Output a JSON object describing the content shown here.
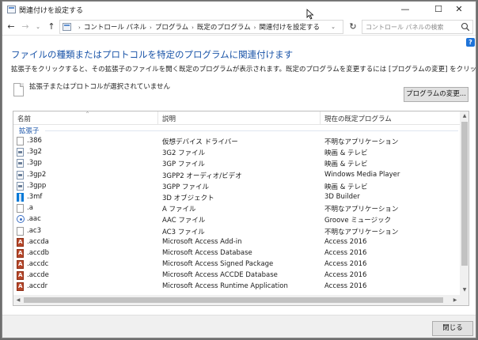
{
  "window": {
    "title": "関連付けを設定する",
    "controls": {
      "minimize": "—",
      "maximize": "☐",
      "close": "✕"
    }
  },
  "nav": {
    "back": "←",
    "forward": "→",
    "recent": "⌄",
    "up": "↑",
    "breadcrumbs": [
      "コントロール パネル",
      "プログラム",
      "既定のプログラム",
      "関連付けを設定する"
    ],
    "breadcrumb_sep": "›",
    "refresh": "↻",
    "address_dropdown": "⌄",
    "search_placeholder": "コントロール パネルの検索"
  },
  "help_label": "?",
  "page": {
    "heading": "ファイルの種類またはプロトコルを特定のプログラムに関連付けます",
    "description": "拡張子をクリックすると、その拡張子のファイルを開く既定のプログラムが表示されます。既定のプログラムを変更するには [プログラムの変更] をクリックしてください。",
    "no_selection": "拡張子またはプロトコルが選択されていません",
    "change_button": "プログラムの変更..."
  },
  "list": {
    "columns": [
      "名前",
      "説明",
      "現在の既定プログラム"
    ],
    "sort_indicator": "^",
    "group": "拡張子",
    "rows": [
      {
        "name": ".386",
        "desc": "仮想デバイス ドライバー",
        "program": "不明なアプリケーション",
        "icon": "generic"
      },
      {
        "name": ".3g2",
        "desc": "3G2 ファイル",
        "program": "映画 & テレビ",
        "icon": "video"
      },
      {
        "name": ".3gp",
        "desc": "3GP ファイル",
        "program": "映画 & テレビ",
        "icon": "video"
      },
      {
        "name": ".3gp2",
        "desc": "3GPP2 オーディオ/ビデオ",
        "program": "Windows Media Player",
        "icon": "video"
      },
      {
        "name": ".3gpp",
        "desc": "3GPP ファイル",
        "program": "映画 & テレビ",
        "icon": "video"
      },
      {
        "name": ".3mf",
        "desc": "3D オブジェクト",
        "program": "3D Builder",
        "icon": "builder"
      },
      {
        "name": ".a",
        "desc": "A ファイル",
        "program": "不明なアプリケーション",
        "icon": "generic"
      },
      {
        "name": ".aac",
        "desc": "AAC ファイル",
        "program": "Groove ミュージック",
        "icon": "groove"
      },
      {
        "name": ".ac3",
        "desc": "AC3 ファイル",
        "program": "不明なアプリケーション",
        "icon": "generic"
      },
      {
        "name": ".accda",
        "desc": "Microsoft Access Add-in",
        "program": "Access 2016",
        "icon": "access"
      },
      {
        "name": ".accdb",
        "desc": "Microsoft Access Database",
        "program": "Access 2016",
        "icon": "access"
      },
      {
        "name": ".accdc",
        "desc": "Microsoft Access Signed Package",
        "program": "Access 2016",
        "icon": "access"
      },
      {
        "name": ".accde",
        "desc": "Microsoft Access ACCDE Database",
        "program": "Access 2016",
        "icon": "access"
      },
      {
        "name": ".accdr",
        "desc": "Microsoft Access Runtime Application",
        "program": "Access 2016",
        "icon": "access"
      }
    ]
  },
  "scroll": {
    "up": "▲",
    "down": "▼",
    "left": "◀",
    "right": "▶"
  },
  "footer": {
    "close_button": "閉じる"
  },
  "colors": {
    "heading": "#1a54a8",
    "group": "#1a54a8",
    "help": "#1e73d8",
    "access_icon": "#b7472a"
  }
}
